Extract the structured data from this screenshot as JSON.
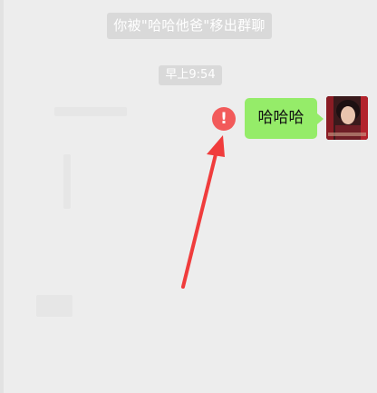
{
  "chat": {
    "system_notice": "你被\"哈哈他爸\"移出群聊",
    "timestamp": "早上9:54",
    "messages": [
      {
        "text": "哈哈哈",
        "status": "send-failed",
        "bubble_color": "#95ec69"
      }
    ]
  },
  "colors": {
    "background": "#ededed",
    "system_pill": "#d9d9d9",
    "error": "#f25a5a",
    "annotation_arrow": "#f03c3c"
  },
  "icons": {
    "error": "exclamation-circle-icon",
    "annotation": "annotation-arrow-icon",
    "avatar": "user-avatar-photo"
  },
  "error_glyph": "!"
}
